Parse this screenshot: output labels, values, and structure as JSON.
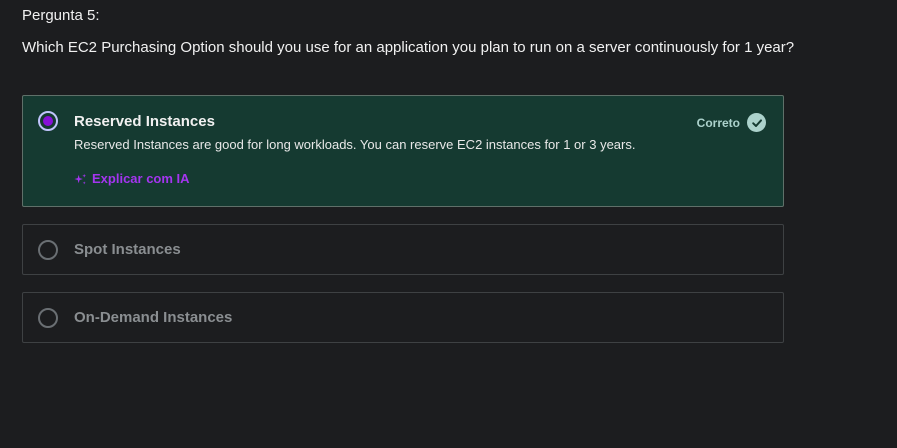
{
  "question": {
    "label": "Pergunta 5:",
    "text": "Which EC2 Purchasing Option should you use for an application you plan to run on a server continuously for 1 year?"
  },
  "options": [
    {
      "label": "Reserved Instances",
      "selected": true,
      "status": "Correto",
      "explanation": "Reserved Instances are good for long workloads. You can reserve EC2 instances for 1 or 3 years.",
      "ai_link": "Explicar com IA"
    },
    {
      "label": "Spot Instances",
      "selected": false
    },
    {
      "label": "On-Demand Instances",
      "selected": false
    }
  ],
  "colors": {
    "background": "#1c1d1f",
    "correct_background": "#153a31",
    "correct_accent": "#acd2cc",
    "brand_purple": "#a435f0",
    "radio_selected": "#8710d8"
  },
  "icons": {
    "correct": "check-circle-icon",
    "ai": "sparkle-icon",
    "radio": "radio-button-icon"
  }
}
